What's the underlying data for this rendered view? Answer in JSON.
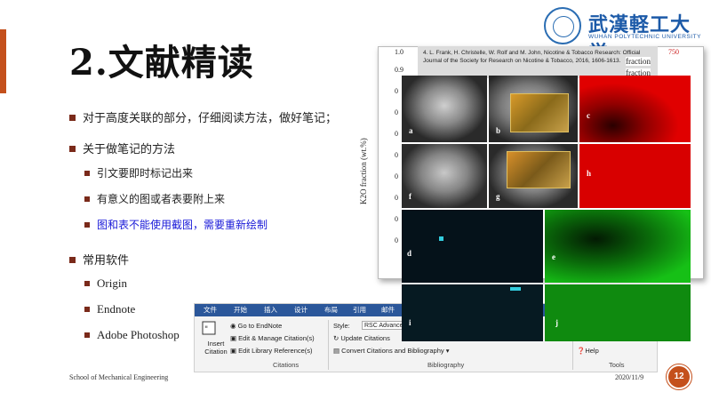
{
  "slide": {
    "title": "2.文献精读",
    "logo": {
      "cn": "武漢軽工大学",
      "en": "WUHAN POLYTECHNIC UNIVERSITY"
    },
    "bullets": {
      "b1": "对于高度关联的部分，仔细阅读方法，做好笔记；",
      "b2": "关于做笔记的方法",
      "b2_sub1": "引文要即时标记出来",
      "b2_sub2": "有意义的图或者表要附上来",
      "b2_sub3": "图和表不能使用截图，需要重新绘制",
      "b3": "常用软件",
      "b3_sub1": "Origin",
      "b3_sub2": "Endnote",
      "b3_sub3": "Adobe Photoshop"
    },
    "footer": {
      "left": "School of Mechanical Engineering",
      "date": "2020/11/9",
      "page": "12"
    },
    "colors": {
      "accent": "#c4501c",
      "highlight_text": "#1a1ad8"
    }
  },
  "ribbon": {
    "tabs": [
      "文件",
      "开始",
      "插入",
      "设计",
      "布局",
      "引用",
      "邮件"
    ],
    "insert_citation": "Insert Citation",
    "go_to_endnote": "Go to EndNote",
    "edit_manage": "Edit & Manage Citation(s)",
    "edit_library": "Edit Library Reference(s)",
    "style_label": "Style:",
    "style_value": "RSC Advances",
    "update_citations": "Update Citations",
    "convert": "Convert Citations and Bibliography",
    "help": "Help",
    "group_citations": "Citations",
    "group_bibliography": "Bibliography",
    "group_tools": "Tools"
  },
  "figure": {
    "reference": "4.   L. Frank, H. Christelle, W. Rolf and M. John, Nicotine & Tobacco Research: Official Journal of the Society for Research on Nicotine & Tobacco, 2016, 1606-1613.",
    "ylabel": "K2O fraction (wt.%)",
    "yticks": [
      "1.0",
      "0.9",
      "0",
      "0",
      "0",
      "0",
      "0",
      "0",
      "0",
      "0"
    ],
    "frac1": "fraction",
    "frac2": "fraction",
    "n750": "750",
    "panel_labels": [
      "a",
      "b",
      "c",
      "d",
      "e",
      "f",
      "g",
      "h",
      "i",
      "j"
    ]
  }
}
